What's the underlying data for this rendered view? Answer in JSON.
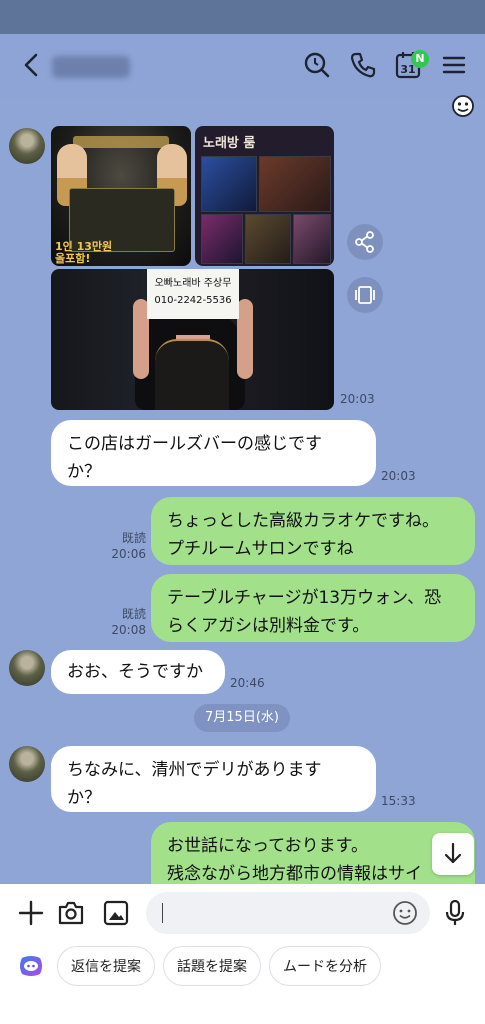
{
  "header": {
    "contact_name": "",
    "calendar_day": "31",
    "calendar_badge": "N"
  },
  "images": {
    "ad_price_line1": "1인 13만원",
    "ad_price_line2": "올포함!",
    "room_title": "노래방 룸",
    "sign_line1": "오빠노래바 주상무",
    "sign_line2": "010-2242-5536"
  },
  "messages": [
    {
      "side": "in",
      "time": "20:03"
    },
    {
      "side": "in",
      "text": "この店はガールズバーの感じです\nか？",
      "time": "20:03"
    },
    {
      "side": "out",
      "text": "ちょっとした高級カラオケですね。\nプチルームサロンですね",
      "read": "既読",
      "time": "20:06"
    },
    {
      "side": "out",
      "text": "テーブルチャージが13万ウォン、恐\nらくアガシは別料金です。",
      "read": "既読",
      "time": "20:08"
    },
    {
      "side": "in",
      "text": "おお、そうですか",
      "time": "20:46"
    },
    {
      "side": "in",
      "text": "ちなみに、清州でデリがあります\nか？",
      "time": "15:33"
    },
    {
      "side": "out",
      "text": "お世話になっております。\n残念ながら地方都市の情報はサイ"
    }
  ],
  "date_separator": "7月15日(水)",
  "input": {
    "placeholder": ""
  },
  "suggestions": [
    "返信を提案",
    "話題を提案",
    "ムードを分析"
  ],
  "colors": {
    "background": "#8fa5d5",
    "outgoing_bubble": "#a3e08a",
    "incoming_bubble": "#ffffff",
    "badge": "#30c84e"
  }
}
